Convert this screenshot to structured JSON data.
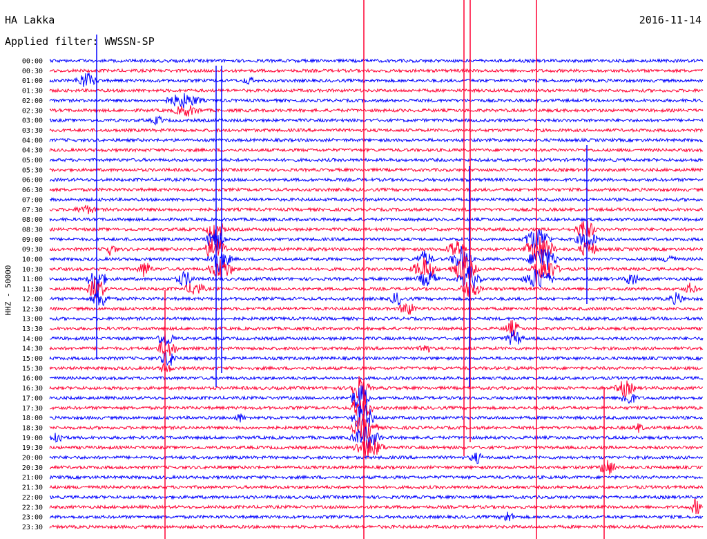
{
  "header": {
    "station": "HA Lakka",
    "date": "2016-11-14",
    "filter": "Applied filter: WWSSN-SP"
  },
  "chart_data": {
    "type": "line",
    "title": "HA Lakka",
    "date": "2016-11-14",
    "ylabel": "HHZ - 50000",
    "trace_colors": [
      "#0000ff",
      "#ff0033"
    ],
    "rows": [
      "00:00",
      "00:30",
      "01:00",
      "01:30",
      "02:00",
      "02:30",
      "03:00",
      "03:30",
      "04:00",
      "04:30",
      "05:00",
      "05:30",
      "06:00",
      "06:30",
      "07:00",
      "07:30",
      "08:00",
      "08:30",
      "09:00",
      "09:30",
      "10:00",
      "10:30",
      "11:00",
      "11:30",
      "12:00",
      "12:30",
      "13:00",
      "13:30",
      "14:00",
      "14:30",
      "15:00",
      "15:30",
      "16:00",
      "16:30",
      "17:00",
      "17:30",
      "18:00",
      "18:30",
      "19:00",
      "19:30",
      "20:00",
      "20:30",
      "21:00",
      "21:30",
      "22:00",
      "22:30",
      "23:00",
      "23:30"
    ],
    "grid": false
  }
}
